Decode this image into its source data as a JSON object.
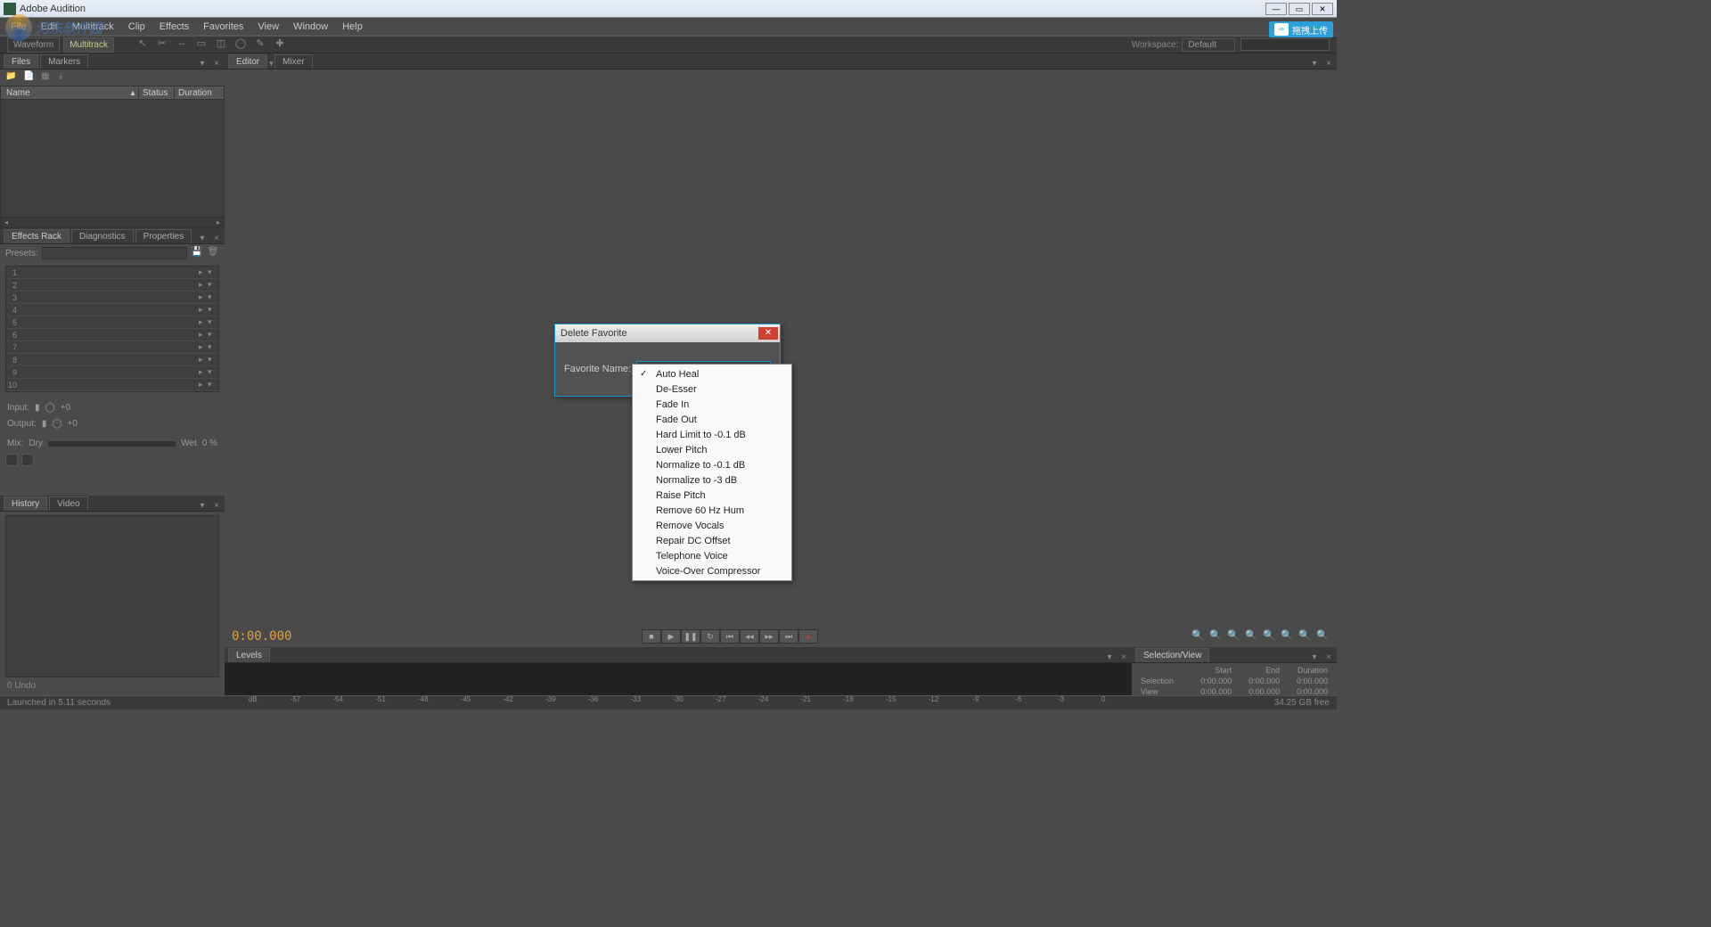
{
  "titlebar": {
    "title": "Adobe Audition"
  },
  "menu": {
    "file": "File",
    "edit": "Edit",
    "multitrack": "Multitrack",
    "clip": "Clip",
    "effects": "Effects",
    "favorites": "Favorites",
    "view": "View",
    "window": "Window",
    "help": "Help"
  },
  "watermark": "河东软件园",
  "cc_button": "拖拽上传",
  "mode": {
    "waveform": "Waveform",
    "multitrack": "Multitrack",
    "workspace_label": "Workspace:",
    "workspace_value": "Default"
  },
  "panels": {
    "files": {
      "tab": "Files",
      "markers_tab": "Markers",
      "col_name": "Name",
      "col_status": "Status",
      "col_duration": "Duration"
    },
    "fx": {
      "tab": "Effects Rack",
      "diag_tab": "Diagnostics",
      "prop_tab": "Properties",
      "presets": "Presets:",
      "input": "Input:",
      "output": "Output:",
      "mix": "Mix:",
      "dry": "Dry",
      "wet": "Wet",
      "wet_val": "0 %",
      "io_val": "+0"
    },
    "history": {
      "tab": "History",
      "video_tab": "Video",
      "undo": "0 Undo"
    },
    "editor": {
      "tab": "Editor",
      "mixer_tab": "Mixer"
    },
    "levels": {
      "tab": "Levels",
      "db": "dB",
      "scale": [
        "-57",
        "-54",
        "-51",
        "-48",
        "-45",
        "-42",
        "-39",
        "-36",
        "-33",
        "-30",
        "-27",
        "-24",
        "-21",
        "-18",
        "-15",
        "-12",
        "-9",
        "-6",
        "-3",
        "0"
      ]
    },
    "selview": {
      "tab": "Selection/View",
      "start": "Start",
      "end": "End",
      "duration": "Duration",
      "selection": "Selection",
      "view": "View",
      "val": "0:00.000"
    }
  },
  "timecode": "0:00.000",
  "dialog": {
    "title": "Delete Favorite",
    "label": "Favorite Name:",
    "selected": "Auto Heal"
  },
  "dropdown": [
    "Auto Heal",
    "De-Esser",
    "Fade In",
    "Fade Out",
    "Hard Limit to -0.1 dB",
    "Lower Pitch",
    "Normalize to -0.1 dB",
    "Normalize to -3 dB",
    "Raise Pitch",
    "Remove 60 Hz Hum",
    "Remove Vocals",
    "Repair DC Offset",
    "Telephone Voice",
    "Voice-Over Compressor"
  ],
  "status": {
    "left": "Launched in 5.11 seconds",
    "right": "34.25 GB free"
  }
}
